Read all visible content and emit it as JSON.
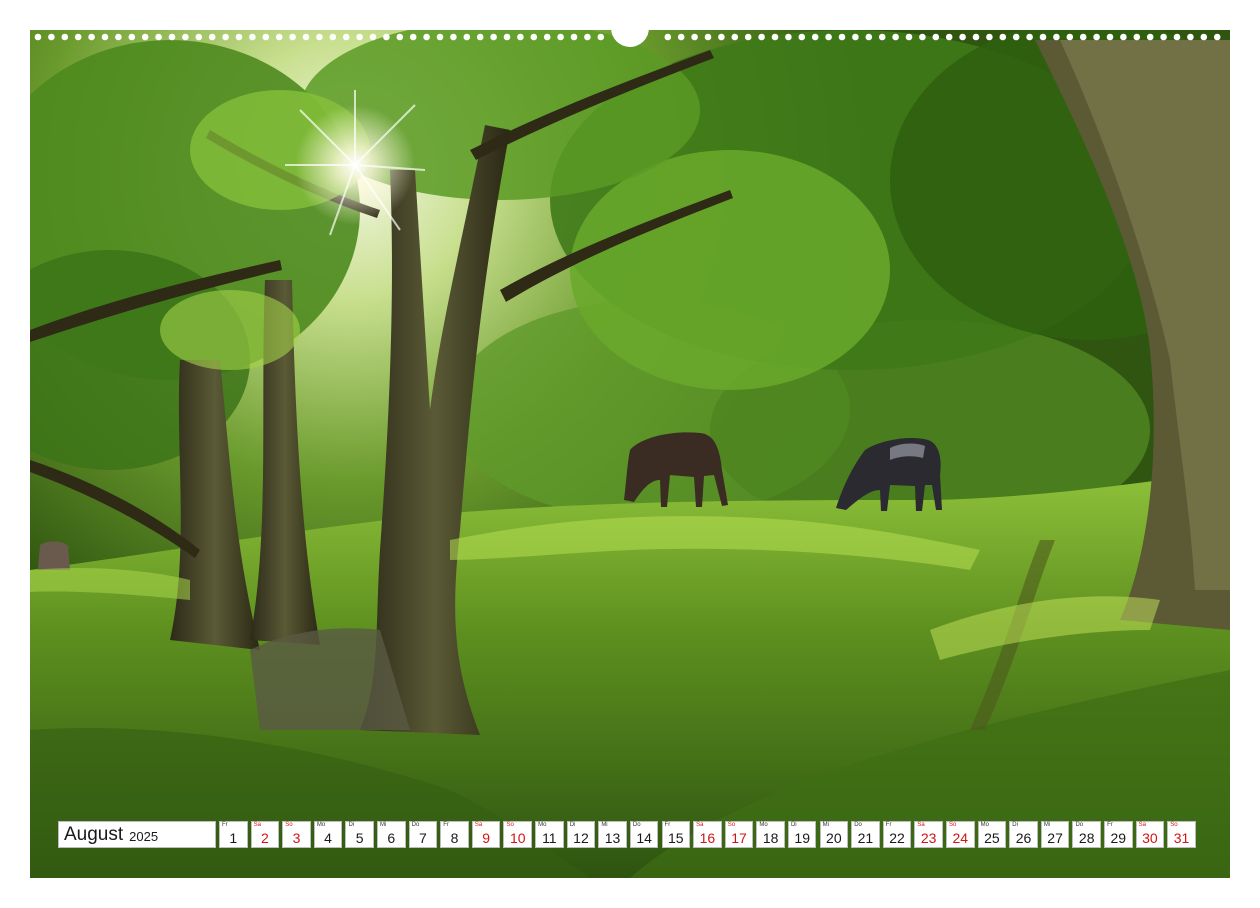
{
  "calendar": {
    "month": "August",
    "year": "2025",
    "weekend_color": "#d21414",
    "days": [
      {
        "wd": "Fr",
        "num": "1",
        "weekend": false
      },
      {
        "wd": "Sa",
        "num": "2",
        "weekend": true
      },
      {
        "wd": "So",
        "num": "3",
        "weekend": true
      },
      {
        "wd": "Mo",
        "num": "4",
        "weekend": false
      },
      {
        "wd": "Di",
        "num": "5",
        "weekend": false
      },
      {
        "wd": "Mi",
        "num": "6",
        "weekend": false
      },
      {
        "wd": "Do",
        "num": "7",
        "weekend": false
      },
      {
        "wd": "Fr",
        "num": "8",
        "weekend": false
      },
      {
        "wd": "Sa",
        "num": "9",
        "weekend": true
      },
      {
        "wd": "So",
        "num": "10",
        "weekend": true
      },
      {
        "wd": "Mo",
        "num": "11",
        "weekend": false
      },
      {
        "wd": "Di",
        "num": "12",
        "weekend": false
      },
      {
        "wd": "Mi",
        "num": "13",
        "weekend": false
      },
      {
        "wd": "Do",
        "num": "14",
        "weekend": false
      },
      {
        "wd": "Fr",
        "num": "15",
        "weekend": false
      },
      {
        "wd": "Sa",
        "num": "16",
        "weekend": true
      },
      {
        "wd": "So",
        "num": "17",
        "weekend": true
      },
      {
        "wd": "Mo",
        "num": "18",
        "weekend": false
      },
      {
        "wd": "Di",
        "num": "19",
        "weekend": false
      },
      {
        "wd": "Mi",
        "num": "20",
        "weekend": false
      },
      {
        "wd": "Do",
        "num": "21",
        "weekend": false
      },
      {
        "wd": "Fr",
        "num": "22",
        "weekend": false
      },
      {
        "wd": "Sa",
        "num": "23",
        "weekend": true
      },
      {
        "wd": "So",
        "num": "24",
        "weekend": true
      },
      {
        "wd": "Mo",
        "num": "25",
        "weekend": false
      },
      {
        "wd": "Di",
        "num": "26",
        "weekend": false
      },
      {
        "wd": "Mi",
        "num": "27",
        "weekend": false
      },
      {
        "wd": "Do",
        "num": "28",
        "weekend": false
      },
      {
        "wd": "Fr",
        "num": "29",
        "weekend": false
      },
      {
        "wd": "Sa",
        "num": "30",
        "weekend": true
      },
      {
        "wd": "So",
        "num": "31",
        "weekend": true
      }
    ]
  }
}
